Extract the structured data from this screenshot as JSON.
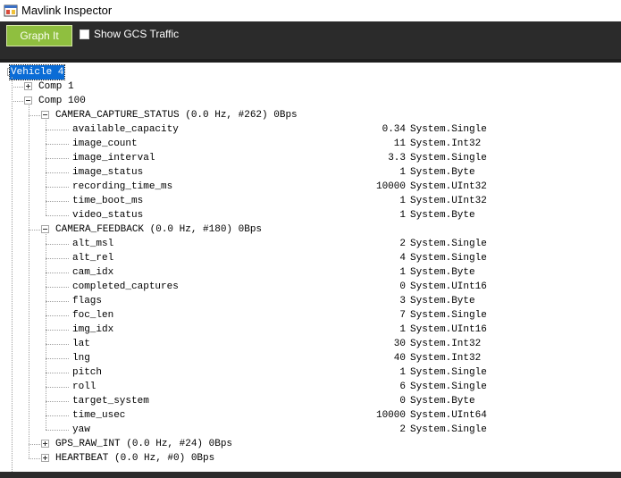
{
  "window": {
    "title": "Mavlink Inspector"
  },
  "toolbar": {
    "graph_label": "Graph It",
    "gcs_label": "Show GCS Traffic",
    "gcs_checked": false
  },
  "tree": {
    "vehicle": "Vehicle 4",
    "comp1": "Comp 1",
    "comp100": "Comp 100",
    "messages": [
      {
        "label": "CAMERA_CAPTURE_STATUS (0.0 Hz, #262) 0Bps",
        "fields": [
          {
            "name": "available_capacity",
            "value": "0.34",
            "type": "System.Single"
          },
          {
            "name": "image_count",
            "value": "11",
            "type": "System.Int32"
          },
          {
            "name": "image_interval",
            "value": "3.3",
            "type": "System.Single"
          },
          {
            "name": "image_status",
            "value": "1",
            "type": "System.Byte"
          },
          {
            "name": "recording_time_ms",
            "value": "10000",
            "type": "System.UInt32"
          },
          {
            "name": "time_boot_ms",
            "value": "1",
            "type": "System.UInt32"
          },
          {
            "name": "video_status",
            "value": "1",
            "type": "System.Byte"
          }
        ]
      },
      {
        "label": "CAMERA_FEEDBACK (0.0 Hz, #180) 0Bps",
        "fields": [
          {
            "name": "alt_msl",
            "value": "2",
            "type": "System.Single"
          },
          {
            "name": "alt_rel",
            "value": "4",
            "type": "System.Single"
          },
          {
            "name": "cam_idx",
            "value": "1",
            "type": "System.Byte"
          },
          {
            "name": "completed_captures",
            "value": "0",
            "type": "System.UInt16"
          },
          {
            "name": "flags",
            "value": "3",
            "type": "System.Byte"
          },
          {
            "name": "foc_len",
            "value": "7",
            "type": "System.Single"
          },
          {
            "name": "img_idx",
            "value": "1",
            "type": "System.UInt16"
          },
          {
            "name": "lat",
            "value": "30",
            "type": "System.Int32"
          },
          {
            "name": "lng",
            "value": "40",
            "type": "System.Int32"
          },
          {
            "name": "pitch",
            "value": "1",
            "type": "System.Single"
          },
          {
            "name": "roll",
            "value": "6",
            "type": "System.Single"
          },
          {
            "name": "target_system",
            "value": "0",
            "type": "System.Byte"
          },
          {
            "name": "time_usec",
            "value": "10000",
            "type": "System.UInt64"
          },
          {
            "name": "yaw",
            "value": "2",
            "type": "System.Single"
          }
        ]
      }
    ],
    "collapsed": [
      "GPS_RAW_INT (0.0 Hz, #24) 0Bps",
      "HEARTBEAT (0.0 Hz, #0) 0Bps"
    ]
  }
}
